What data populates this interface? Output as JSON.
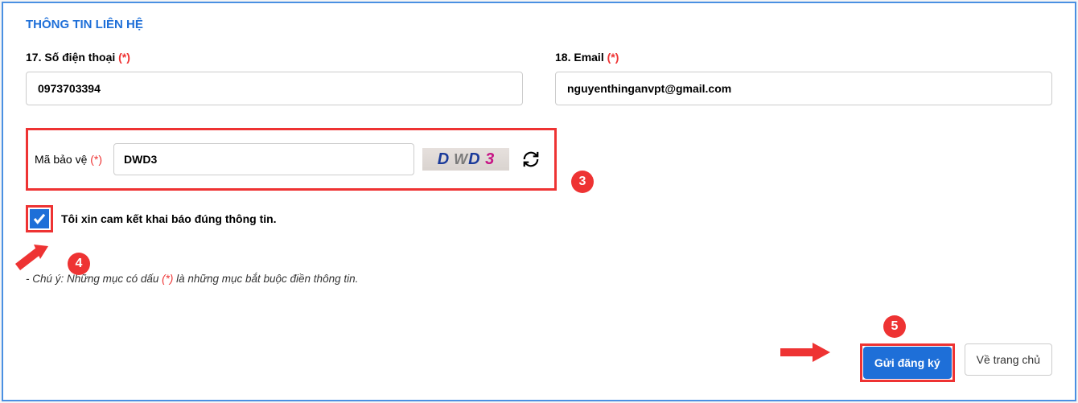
{
  "section_title": "THÔNG TIN LIÊN HỆ",
  "field17": {
    "label": "17. Số điện thoại",
    "required": "(*)",
    "value": "0973703394"
  },
  "field18": {
    "label": "18. Email",
    "required": "(*)",
    "value": "nguyenthinganvpt@gmail.com"
  },
  "captcha": {
    "label": "Mã bảo vệ",
    "required": "(*)",
    "value": "DWD3",
    "image_text": "D WD 3"
  },
  "checkbox_label": "Tôi xin cam kết khai báo đúng thông tin.",
  "note_prefix": "- Chú ý: Những mục có dấu ",
  "note_mark": "(*)",
  "note_suffix": " là những mục bắt buộc điền thông tin.",
  "buttons": {
    "submit": "Gửi đăng ký",
    "home": "Về trang chủ"
  },
  "badges": {
    "b3": "3",
    "b4": "4",
    "b5": "5"
  }
}
